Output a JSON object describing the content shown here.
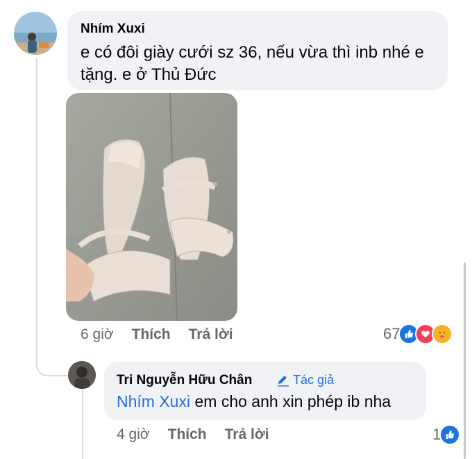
{
  "comment": {
    "author": "Nhím Xuxi",
    "text": "e có đôi giày cưới sz 36, nếu vừa thì inb nhé e tặng. e ở Thủ Đức",
    "time": "6 giờ",
    "like_label": "Thích",
    "reply_label": "Trả lời",
    "reaction_count": "67",
    "reactions": [
      "like-icon",
      "love-icon",
      "care-icon"
    ]
  },
  "reply": {
    "author": "Tri Nguyễn Hữu Chân",
    "author_badge": "Tác giả",
    "mention": "Nhím Xuxi",
    "text": " em cho anh xin phép ib nha",
    "time": "4 giờ",
    "like_label": "Thích",
    "reply_label": "Trả lời",
    "reaction_count": "1",
    "reactions": [
      "like-icon"
    ]
  },
  "colors": {
    "accent": "#216fdb",
    "bubble": "#f0f2f5",
    "meta_text": "#65676b"
  }
}
